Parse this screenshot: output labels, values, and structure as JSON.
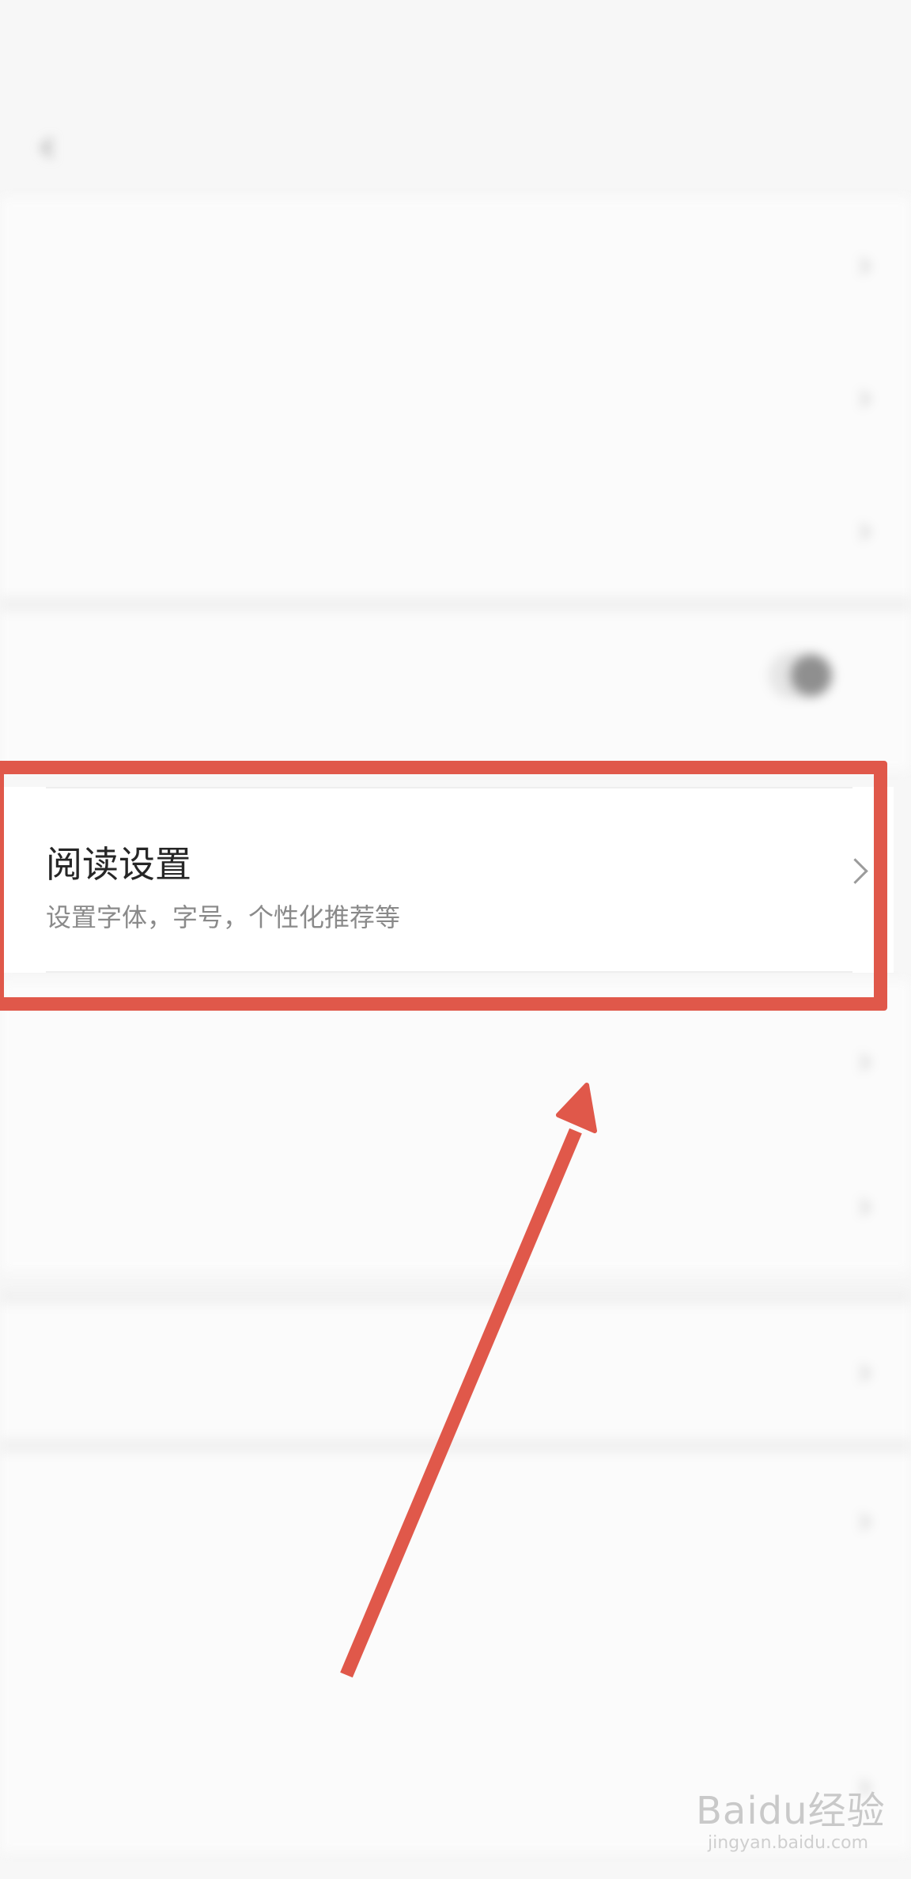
{
  "status": {
    "time": "",
    "right": ""
  },
  "header": {
    "title": ""
  },
  "blurred_rows": [
    {
      "label": ""
    },
    {
      "label": ""
    },
    {
      "label": ""
    },
    {
      "label": "",
      "sub": ""
    },
    {
      "label": "",
      "sub": ""
    },
    {
      "label": "",
      "value": ""
    },
    {
      "label": ""
    },
    {
      "label": "",
      "value": ""
    },
    {
      "label": "",
      "value": ""
    },
    {
      "label": ""
    }
  ],
  "focused_item": {
    "title": "阅读设置",
    "subtitle": "设置字体，字号，个性化推荐等"
  },
  "watermark": {
    "brand": "Baidu经验",
    "url": "jingyan.baidu.com"
  },
  "annotation_color": "#e0584a"
}
